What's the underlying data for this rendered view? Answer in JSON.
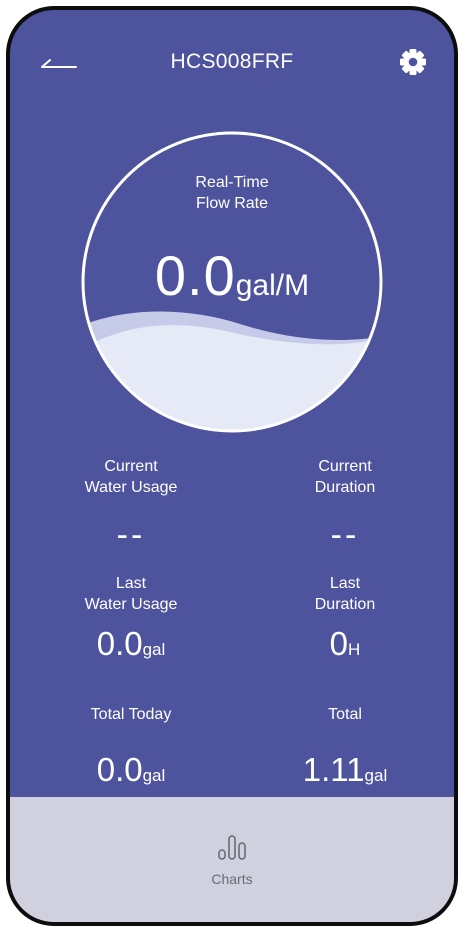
{
  "header": {
    "title": "HCS008FRF"
  },
  "flow": {
    "label_line1": "Real-Time",
    "label_line2": "Flow Rate",
    "value": "0.0",
    "unit": "gal/M"
  },
  "stats": {
    "current_usage": {
      "label_line1": "Current",
      "label_line2": "Water Usage",
      "value": "--"
    },
    "current_duration": {
      "label_line1": "Current",
      "label_line2": "Duration",
      "value": "--"
    },
    "last_usage": {
      "label_line1": "Last",
      "label_line2": "Water Usage",
      "value": "0.0",
      "unit": "gal"
    },
    "last_duration": {
      "label_line1": "Last",
      "label_line2": "Duration",
      "value": "0",
      "unit": "H"
    },
    "total_today": {
      "label": "Total Today",
      "value": "0.0",
      "unit": "gal"
    },
    "total": {
      "label": "Total",
      "value": "1.11",
      "unit": "gal"
    }
  },
  "tabbar": {
    "charts_label": "Charts",
    "icon": "bar-chart-icon"
  },
  "icons": {
    "back": "back-arrow-icon",
    "settings": "gear-icon"
  },
  "colors": {
    "background": "#4e539e",
    "tabbar": "#d1d0de",
    "wave": "#e6e9f6",
    "wave_back": "#c7cbea"
  }
}
